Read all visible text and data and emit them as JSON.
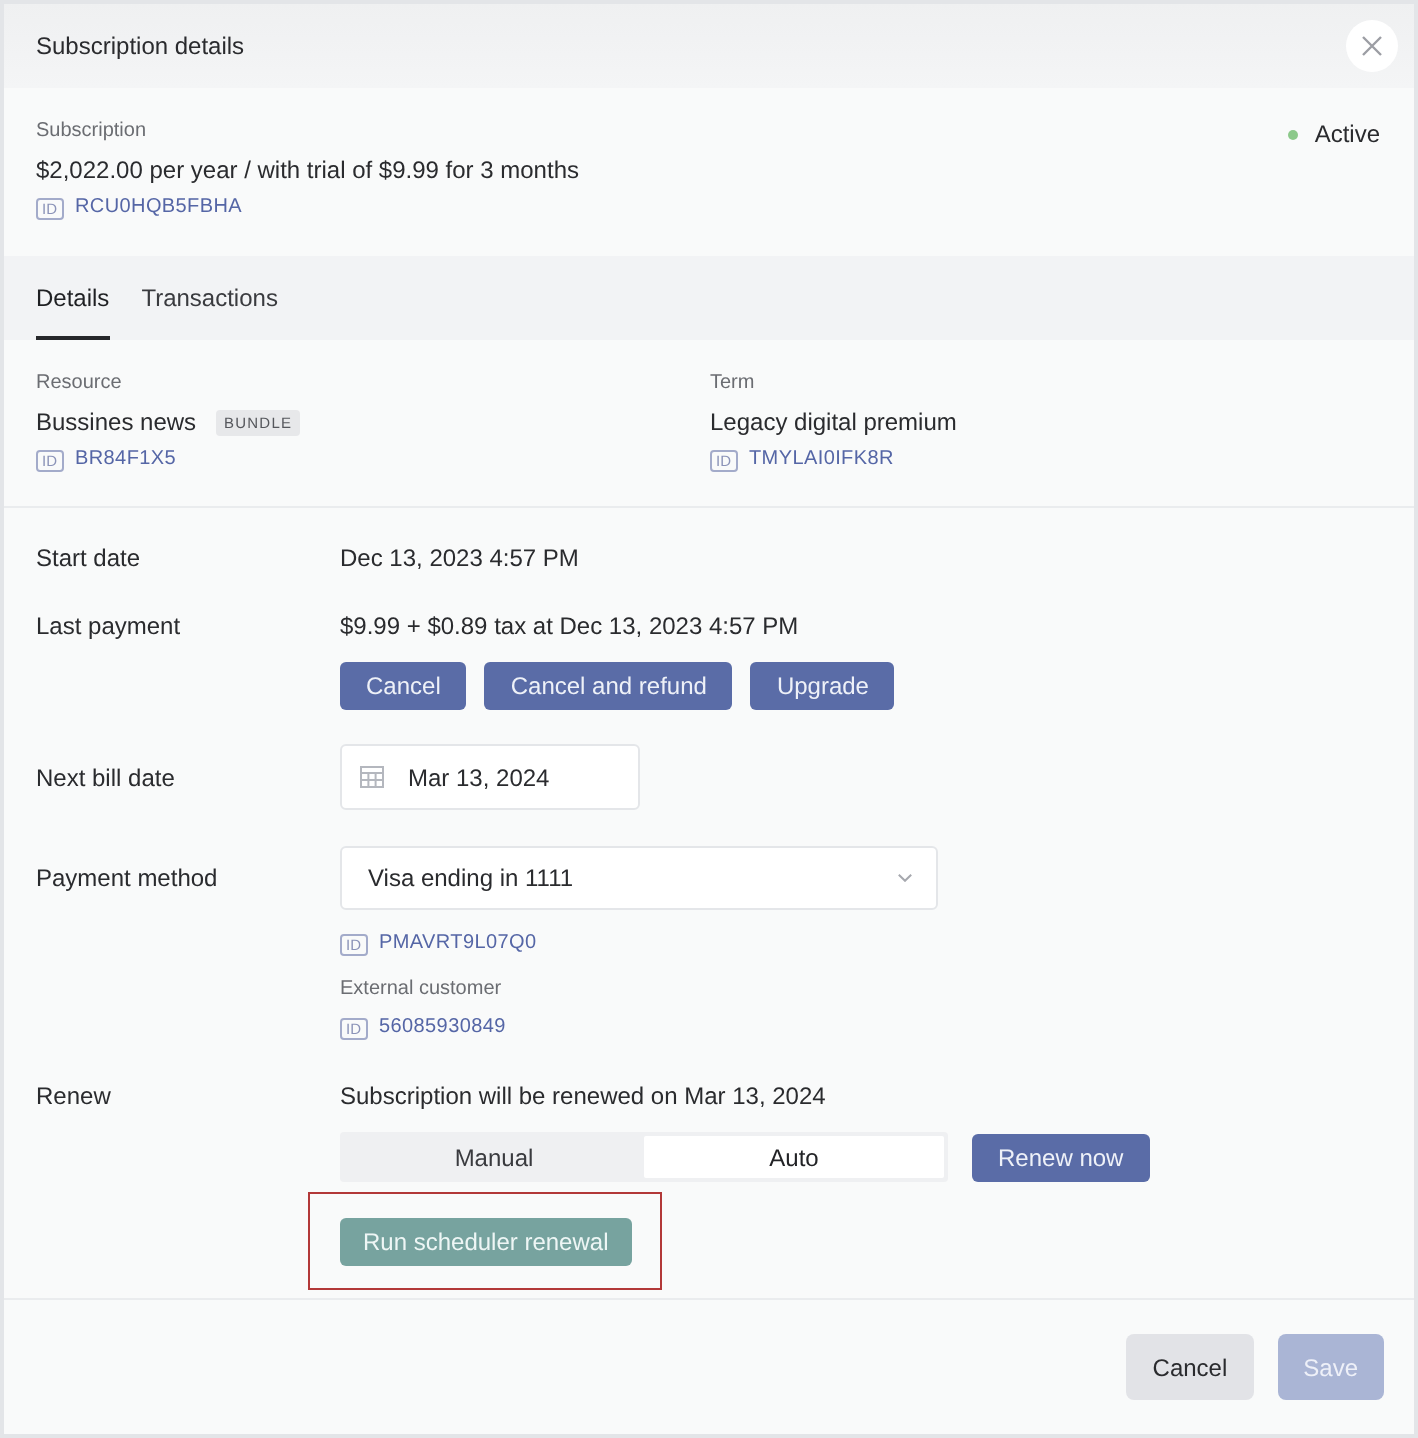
{
  "window": {
    "title": "Subscription details"
  },
  "subscription": {
    "label": "Subscription",
    "value": "$2,022.00 per year / with trial of $9.99 for 3 months",
    "id": {
      "tag": "ID",
      "value": "RCU0HQB5FBHA"
    },
    "status": {
      "label": "Active",
      "color": "#8cc98a"
    }
  },
  "tabs": [
    {
      "label": "Details",
      "selected": true
    },
    {
      "label": "Transactions",
      "selected": false
    }
  ],
  "resources": [
    {
      "label": "Resource",
      "value": "Bussines news",
      "badge": "BUNDLE",
      "id": {
        "tag": "ID",
        "value": "BR84F1X5"
      }
    },
    {
      "label": "Term",
      "value": "Legacy digital premium",
      "id": {
        "tag": "ID",
        "value": "TMYLAI0IFK8R"
      }
    }
  ],
  "rows": [
    {
      "kind": "text",
      "label": "Start date",
      "value": "Dec 13, 2023 4:57 PM"
    },
    {
      "kind": "payment",
      "label": "Last payment",
      "value": "$9.99 + $0.89 tax at Dec 13, 2023 4:57 PM",
      "buttons": [
        {
          "label": "Cancel"
        },
        {
          "label": "Cancel and refund"
        },
        {
          "label": "Upgrade"
        }
      ]
    },
    {
      "kind": "date",
      "label": "Next bill date",
      "value": "Mar 13, 2024"
    },
    {
      "kind": "select",
      "label": "Payment method",
      "value": "Visa ending in 1111",
      "id": {
        "tag": "ID",
        "value": "PMAVRT9L07Q0"
      },
      "extra": {
        "label": "External customer",
        "id": {
          "tag": "ID",
          "value": "56085930849"
        }
      }
    },
    {
      "kind": "renew",
      "label": "Renew",
      "value": "Subscription will be renewed on Mar 13, 2024",
      "modes": [
        {
          "label": "Manual",
          "selected": false
        },
        {
          "label": "Auto",
          "selected": true
        }
      ],
      "action": "Renew now",
      "scheduler": {
        "label": "Run scheduler renewal",
        "highlighted": true
      }
    }
  ],
  "footer": {
    "buttons": [
      {
        "label": "Cancel",
        "kind": "secondary",
        "disabled": false
      },
      {
        "label": "Save",
        "kind": "primary",
        "disabled": true
      }
    ]
  }
}
